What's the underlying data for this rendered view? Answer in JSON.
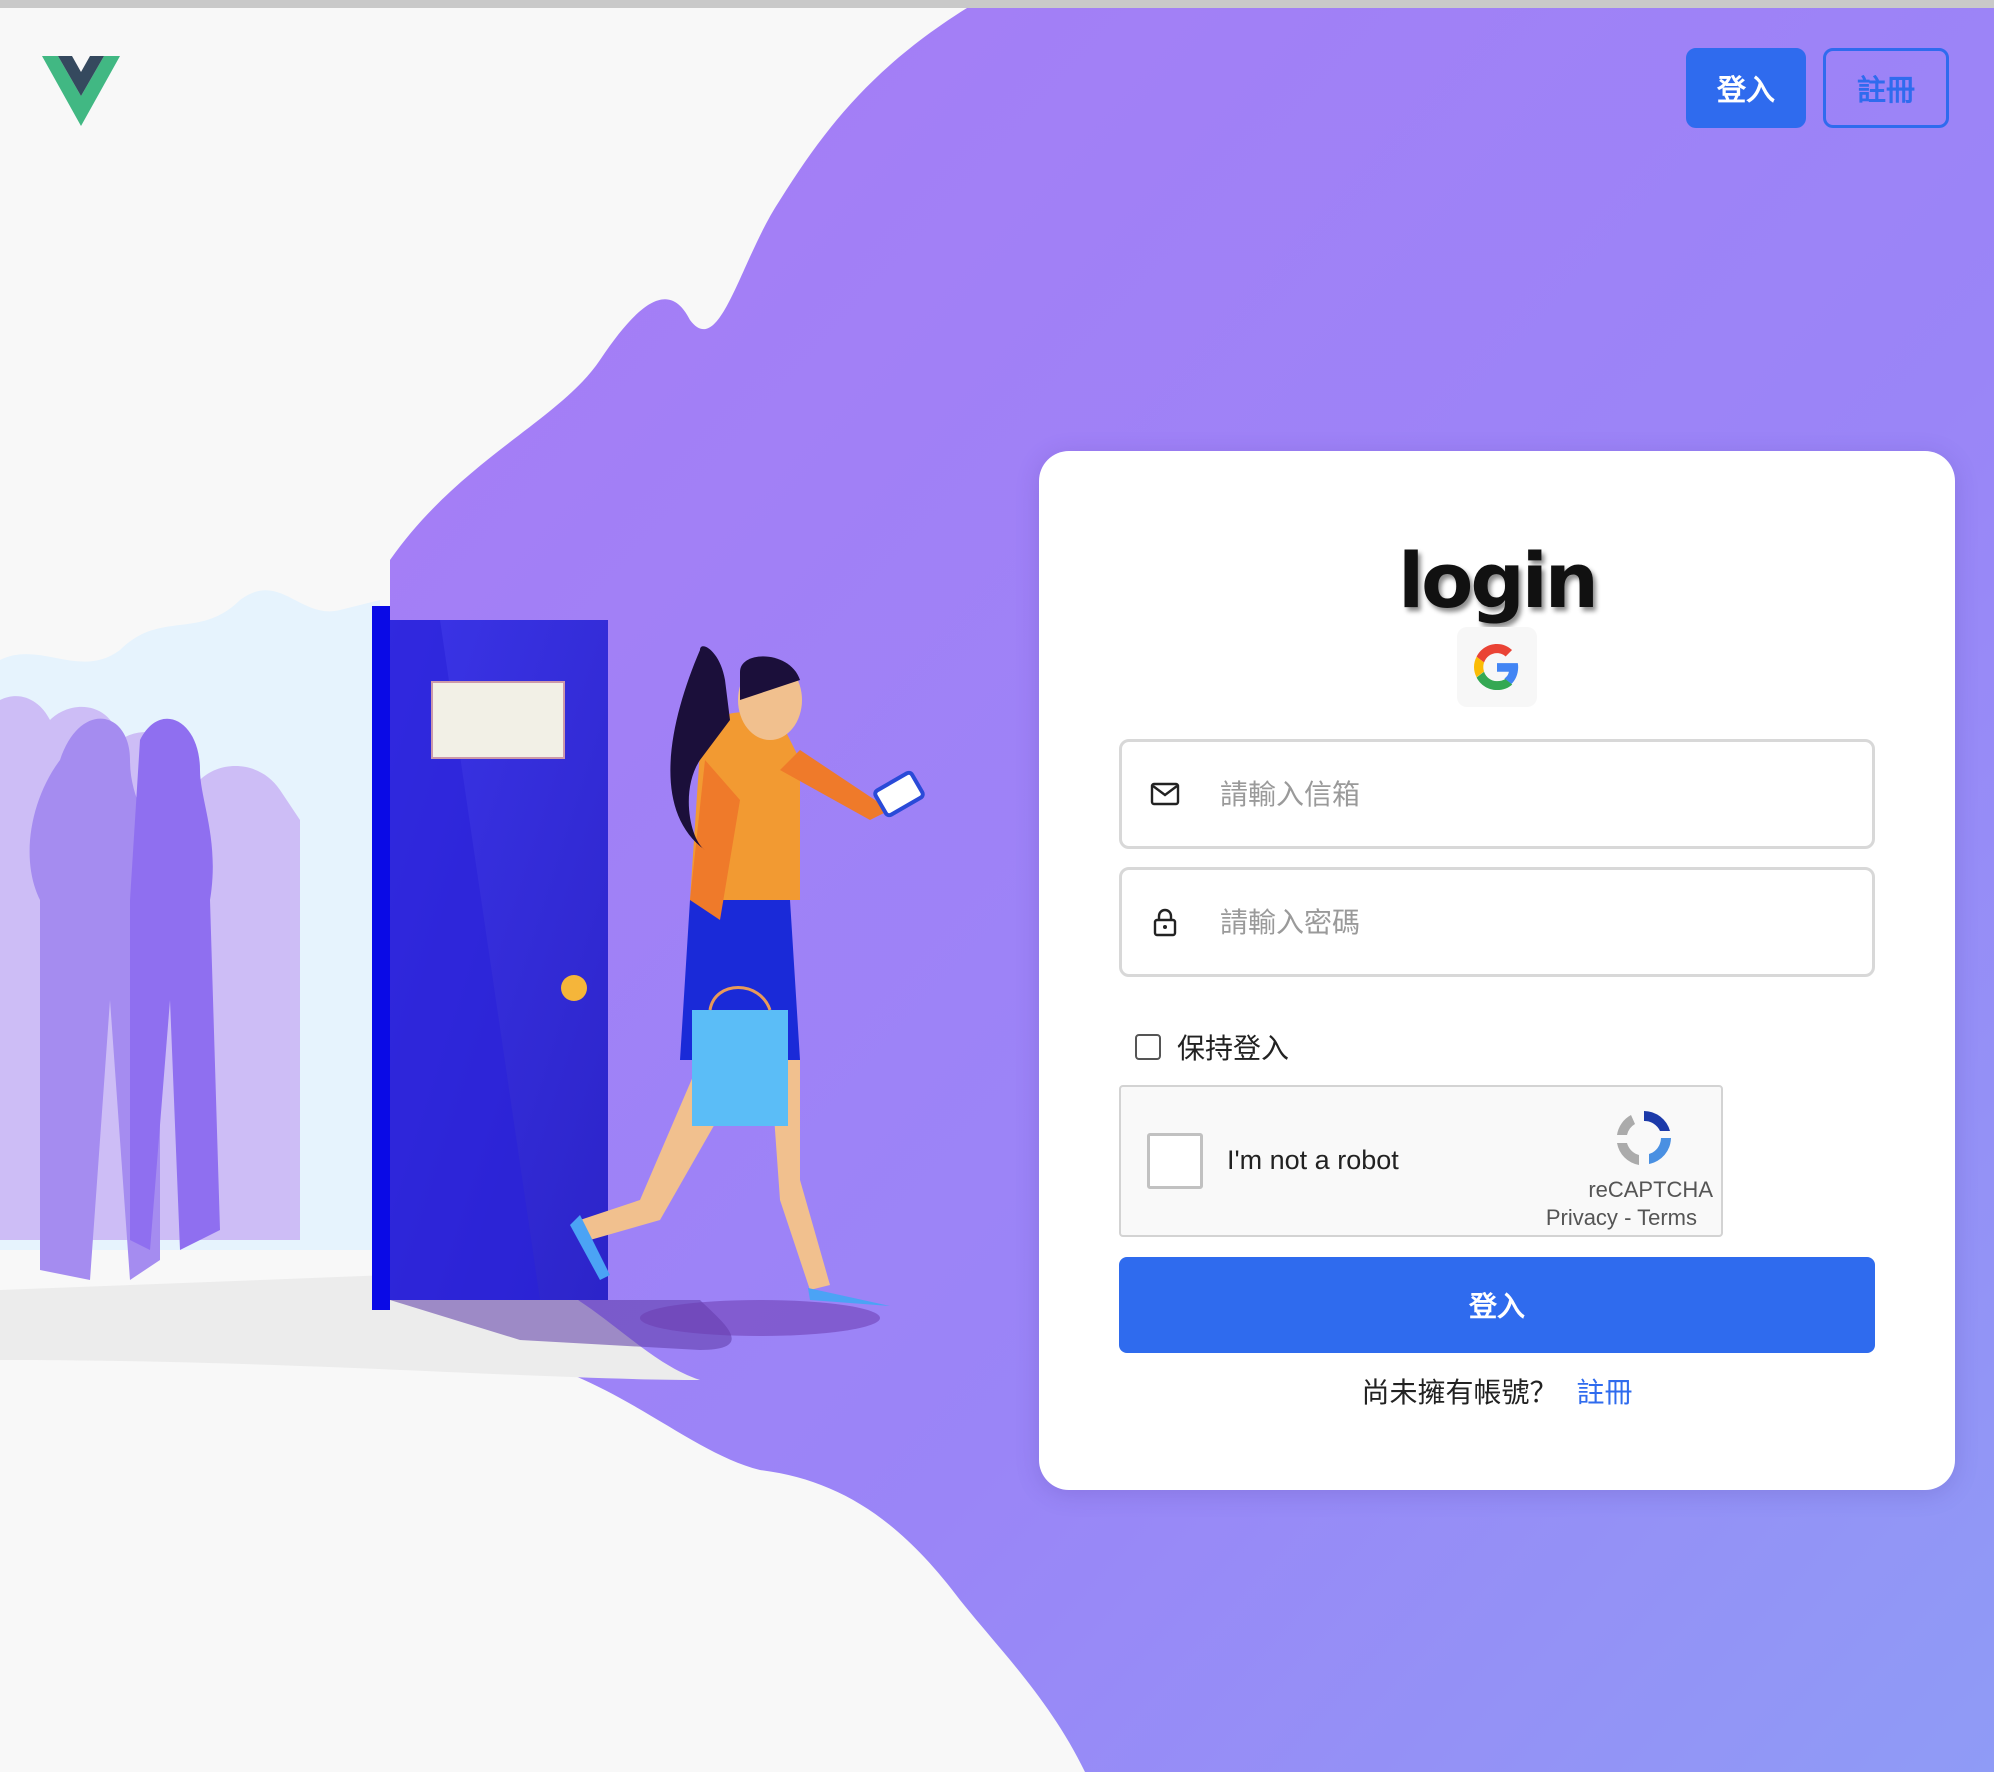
{
  "header": {
    "logo": "vue-logo",
    "login_label": "登入",
    "register_label": "註冊"
  },
  "card": {
    "title": "login",
    "google_icon": "google-icon",
    "email": {
      "placeholder": "請輸入信箱",
      "value": "",
      "icon": "mail-icon"
    },
    "password": {
      "placeholder": "請輸入密碼",
      "value": "",
      "icon": "lock-icon"
    },
    "remember_label": "保持登入",
    "recaptcha": {
      "label": "I'm not a robot",
      "brand": "reCAPTCHA",
      "privacy": "Privacy",
      "separator": "-",
      "terms": "Terms"
    },
    "submit_label": "登入",
    "signup_prompt": "尚未擁有帳號？",
    "signup_link": "註冊"
  },
  "colors": {
    "primary": "#2f6bee",
    "background_purple": "#9b7ef6",
    "door": "#2f2be0"
  }
}
